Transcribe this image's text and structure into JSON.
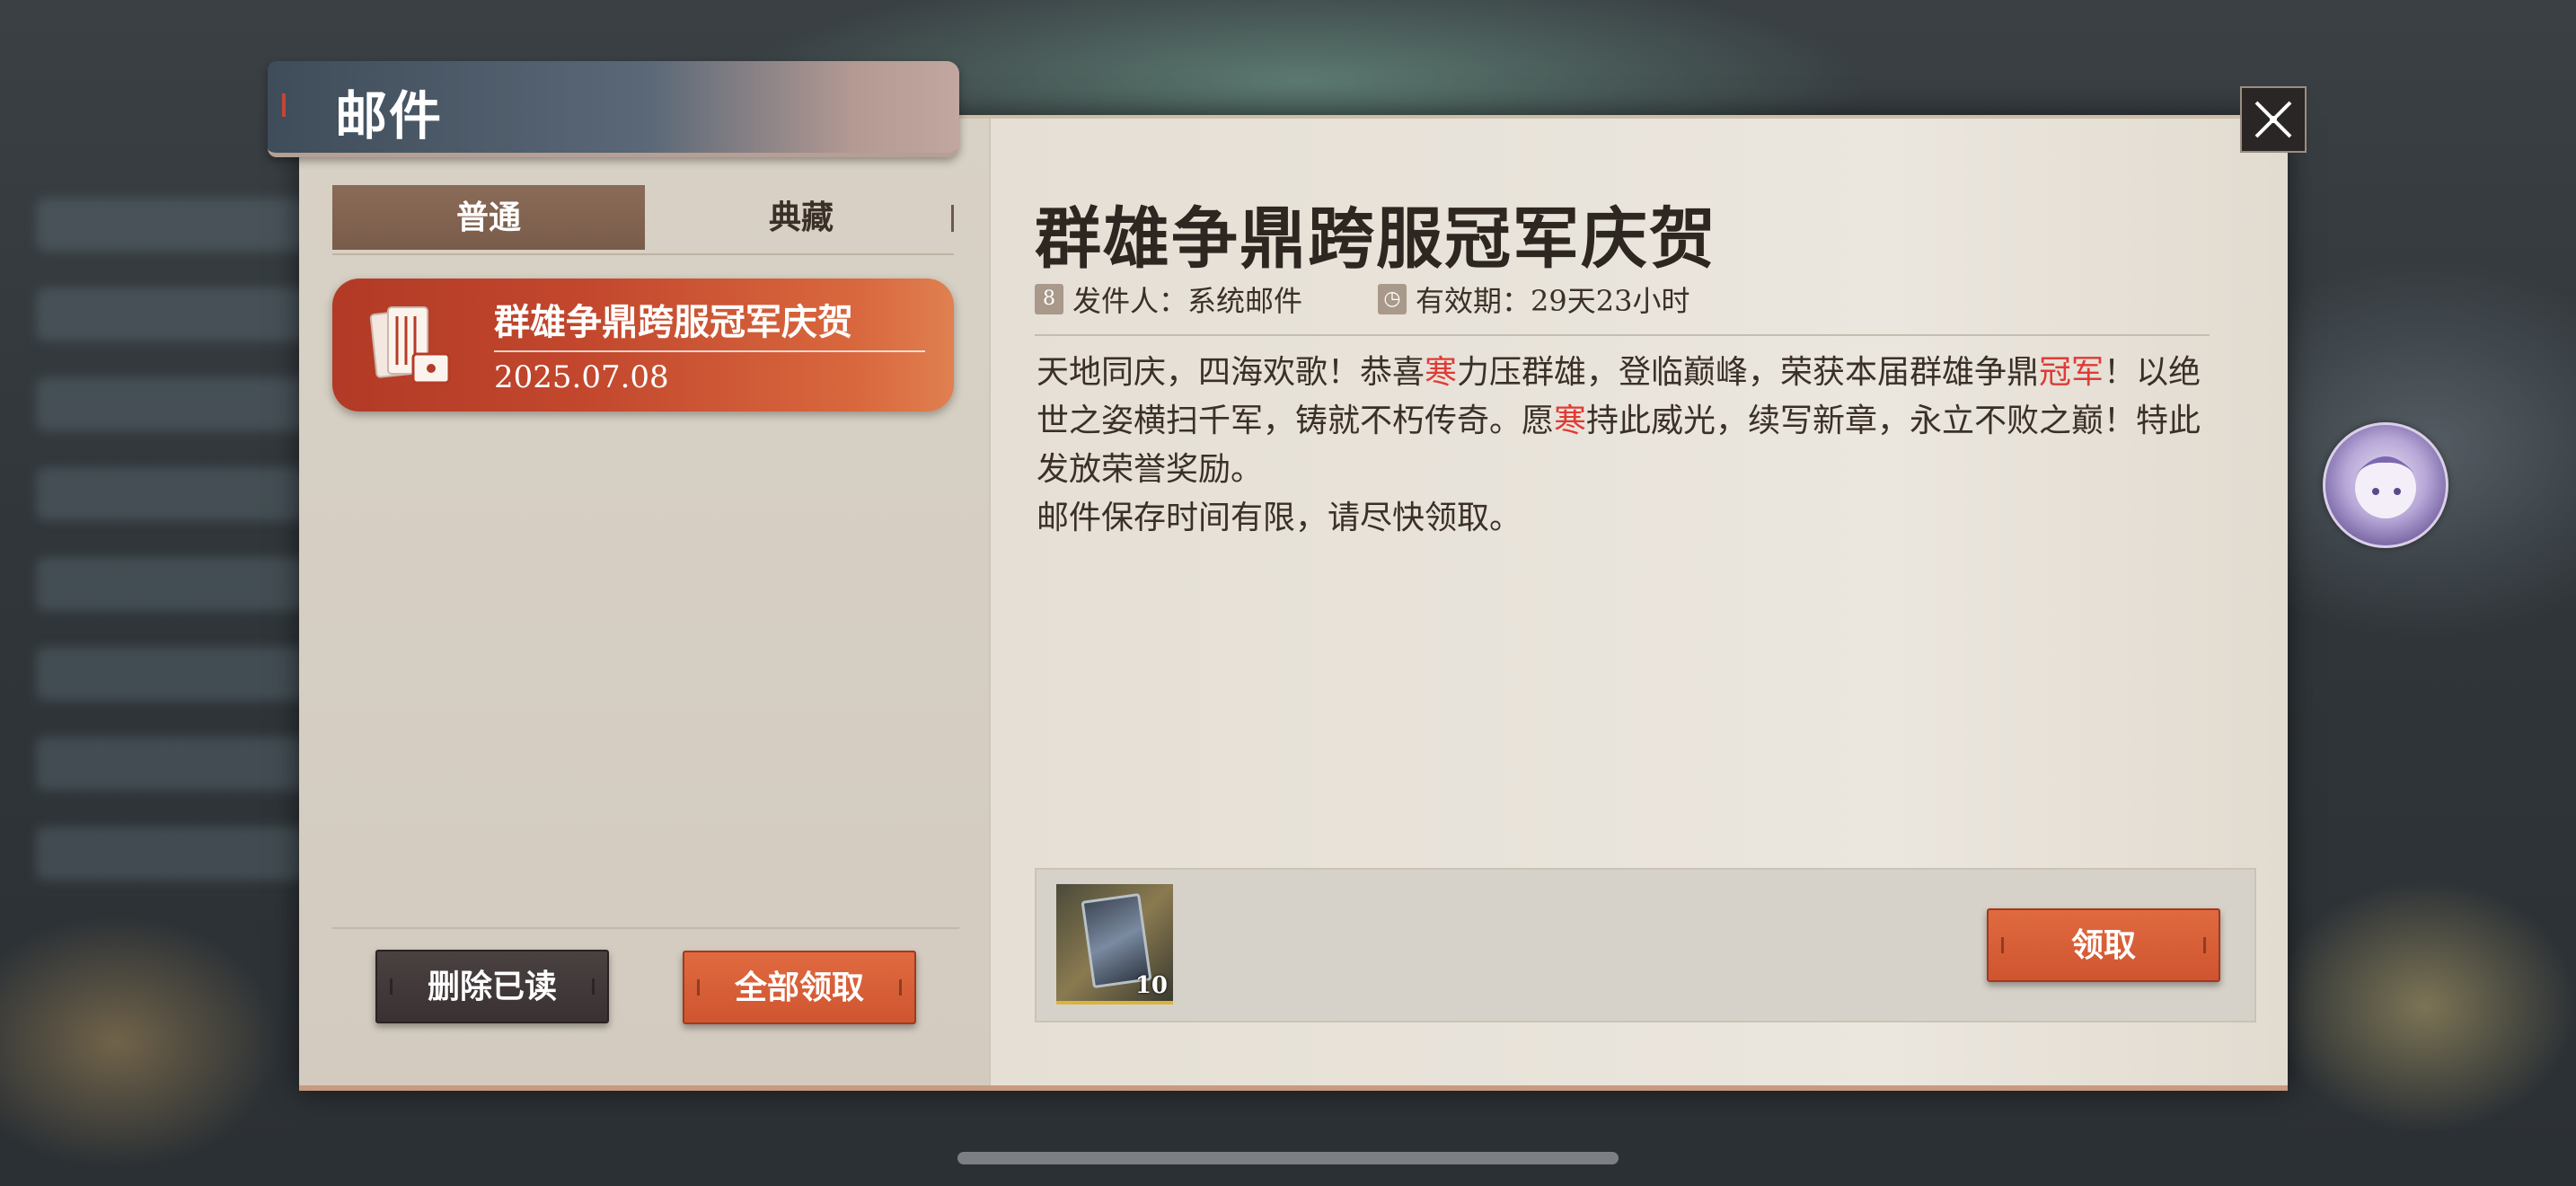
{
  "window": {
    "title": "邮件"
  },
  "tabs": [
    {
      "label": "普通",
      "active": true
    },
    {
      "label": "典藏",
      "active": false
    }
  ],
  "mail_list": [
    {
      "title": "群雄争鼎跨服冠军庆贺",
      "date": "2025.07.08",
      "selected": true
    }
  ],
  "left_actions": {
    "delete_read": "删除已读",
    "claim_all": "全部领取"
  },
  "mail": {
    "title": "群雄争鼎跨服冠军庆贺",
    "sender_label": "发件人：系统邮件",
    "valid_label": "有效期：29天23小时",
    "body": [
      {
        "text": "天地同庆，四海欢歌！恭喜",
        "hl": false
      },
      {
        "text": "寒",
        "hl": true
      },
      {
        "text": "力压群雄，登临巅峰，荣获本届群雄争鼎",
        "hl": false
      },
      {
        "text": "冠军",
        "hl": true
      },
      {
        "text": "！以绝世之姿横扫千军，铸就不朽传奇。愿",
        "hl": false
      },
      {
        "text": "寒",
        "hl": true
      },
      {
        "text": "持此威光，续写新章，永立不败之巅！特此发放荣誉奖励。",
        "hl": false
      }
    ],
    "body_note": "邮件保存时间有限，请尽快领取。",
    "rewards": [
      {
        "icon": "card-item-icon",
        "count": "10"
      }
    ],
    "claim_label": "领取"
  },
  "colors": {
    "highlight": "#e03b35",
    "primary_button": "#d35a34",
    "selected_item": "#c2472d"
  },
  "icons": [
    "close-icon",
    "sender-icon",
    "clock-icon",
    "mail-stack-icon",
    "avatar-icon"
  ]
}
